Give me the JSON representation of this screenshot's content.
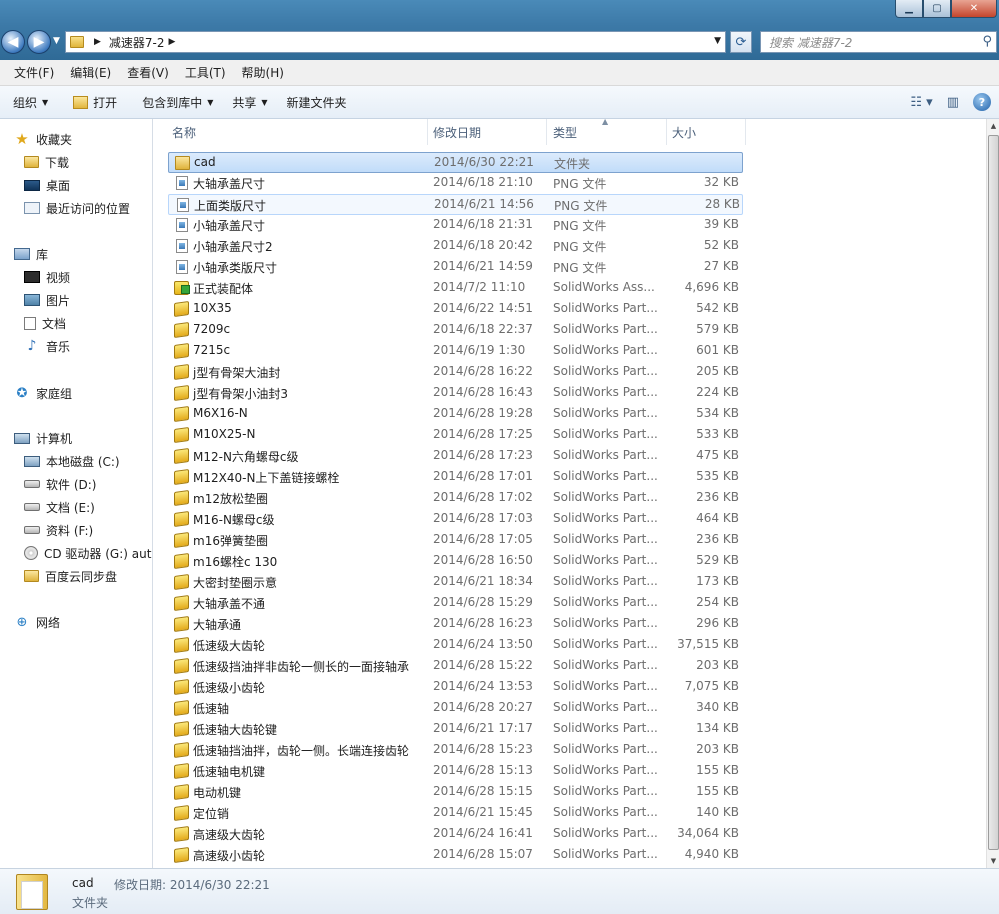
{
  "address": {
    "crumb": "减速器7-2",
    "search_placeholder": "搜索 减速器7-2"
  },
  "menu": [
    "文件(F)",
    "编辑(E)",
    "查看(V)",
    "工具(T)",
    "帮助(H)"
  ],
  "commands": {
    "organize": "组织",
    "open": "打开",
    "include_library": "包含到库中",
    "share": "共享",
    "new_folder": "新建文件夹"
  },
  "nav": {
    "favorites": "收藏夹",
    "downloads": "下载",
    "desktop": "桌面",
    "recent": "最近访问的位置",
    "libraries": "库",
    "videos": "视频",
    "pictures": "图片",
    "documents": "文档",
    "music": "音乐",
    "homegroup": "家庭组",
    "computer": "计算机",
    "drive_c": "本地磁盘 (C:)",
    "drive_d": "软件 (D:)",
    "drive_e": "文档 (E:)",
    "drive_f": "资料 (F:)",
    "drive_g": "CD 驱动器 (G:) auto",
    "baidu": "百度云同步盘",
    "network": "网络"
  },
  "columns": {
    "name": "名称",
    "date": "修改日期",
    "type": "类型",
    "size": "大小"
  },
  "files": [
    {
      "name": "cad",
      "date": "2014/6/30 22:21",
      "type": "文件夹",
      "size": "",
      "icon": "folder-icon"
    },
    {
      "name": "大轴承盖尺寸",
      "date": "2014/6/18 21:10",
      "type": "PNG 文件",
      "size": "32 KB",
      "icon": "png-file-icon"
    },
    {
      "name": "上面类版尺寸",
      "date": "2014/6/21 14:56",
      "type": "PNG 文件",
      "size": "28 KB",
      "icon": "png-file-icon"
    },
    {
      "name": "小轴承盖尺寸",
      "date": "2014/6/18 21:31",
      "type": "PNG 文件",
      "size": "39 KB",
      "icon": "png-file-icon"
    },
    {
      "name": "小轴承盖尺寸2",
      "date": "2014/6/18 20:42",
      "type": "PNG 文件",
      "size": "52 KB",
      "icon": "png-file-icon"
    },
    {
      "name": "小轴承类版尺寸",
      "date": "2014/6/21 14:59",
      "type": "PNG 文件",
      "size": "27 KB",
      "icon": "png-file-icon"
    },
    {
      "name": "正式装配体",
      "date": "2014/7/2 11:10",
      "type": "SolidWorks Ass...",
      "size": "4,696 KB",
      "icon": "assembly-file-icon"
    },
    {
      "name": "10X35",
      "date": "2014/6/22 14:51",
      "type": "SolidWorks Part...",
      "size": "542 KB",
      "icon": "part-file-icon"
    },
    {
      "name": "7209c",
      "date": "2014/6/18 22:37",
      "type": "SolidWorks Part...",
      "size": "579 KB",
      "icon": "part-file-icon"
    },
    {
      "name": "7215c",
      "date": "2014/6/19 1:30",
      "type": "SolidWorks Part...",
      "size": "601 KB",
      "icon": "part-file-icon"
    },
    {
      "name": "j型有骨架大油封",
      "date": "2014/6/28 16:22",
      "type": "SolidWorks Part...",
      "size": "205 KB",
      "icon": "part-file-icon"
    },
    {
      "name": "j型有骨架小油封3",
      "date": "2014/6/28 16:43",
      "type": "SolidWorks Part...",
      "size": "224 KB",
      "icon": "part-file-icon"
    },
    {
      "name": "M6X16-N",
      "date": "2014/6/28 19:28",
      "type": "SolidWorks Part...",
      "size": "534 KB",
      "icon": "part-file-icon"
    },
    {
      "name": "M10X25-N",
      "date": "2014/6/28 17:25",
      "type": "SolidWorks Part...",
      "size": "533 KB",
      "icon": "part-file-icon"
    },
    {
      "name": "M12-N六角螺母c级",
      "date": "2014/6/28 17:23",
      "type": "SolidWorks Part...",
      "size": "475 KB",
      "icon": "part-file-icon"
    },
    {
      "name": "M12X40-N上下盖链接螺栓",
      "date": "2014/6/28 17:01",
      "type": "SolidWorks Part...",
      "size": "535 KB",
      "icon": "part-file-icon"
    },
    {
      "name": "m12放松垫圈",
      "date": "2014/6/28 17:02",
      "type": "SolidWorks Part...",
      "size": "236 KB",
      "icon": "part-file-icon"
    },
    {
      "name": "M16-N螺母c级",
      "date": "2014/6/28 17:03",
      "type": "SolidWorks Part...",
      "size": "464 KB",
      "icon": "part-file-icon"
    },
    {
      "name": "m16弹簧垫圈",
      "date": "2014/6/28 17:05",
      "type": "SolidWorks Part...",
      "size": "236 KB",
      "icon": "part-file-icon"
    },
    {
      "name": "m16螺栓c 130",
      "date": "2014/6/28 16:50",
      "type": "SolidWorks Part...",
      "size": "529 KB",
      "icon": "part-file-icon"
    },
    {
      "name": "大密封垫圈示意",
      "date": "2014/6/21 18:34",
      "type": "SolidWorks Part...",
      "size": "173 KB",
      "icon": "part-file-icon"
    },
    {
      "name": "大轴承盖不通",
      "date": "2014/6/28 15:29",
      "type": "SolidWorks Part...",
      "size": "254 KB",
      "icon": "part-file-icon"
    },
    {
      "name": "大轴承通",
      "date": "2014/6/28 16:23",
      "type": "SolidWorks Part...",
      "size": "296 KB",
      "icon": "part-file-icon"
    },
    {
      "name": "低速级大齿轮",
      "date": "2014/6/24 13:50",
      "type": "SolidWorks Part...",
      "size": "37,515 KB",
      "icon": "part-file-icon"
    },
    {
      "name": "低速级挡油拌非齿轮一侧长的一面接轴承",
      "date": "2014/6/28 15:22",
      "type": "SolidWorks Part...",
      "size": "203 KB",
      "icon": "part-file-icon"
    },
    {
      "name": "低速级小齿轮",
      "date": "2014/6/24 13:53",
      "type": "SolidWorks Part...",
      "size": "7,075 KB",
      "icon": "part-file-icon"
    },
    {
      "name": "低速轴",
      "date": "2014/6/28 20:27",
      "type": "SolidWorks Part...",
      "size": "340 KB",
      "icon": "part-file-icon"
    },
    {
      "name": "低速轴大齿轮键",
      "date": "2014/6/21 17:17",
      "type": "SolidWorks Part...",
      "size": "134 KB",
      "icon": "part-file-icon"
    },
    {
      "name": "低速轴挡油拌，齿轮一侧。长端连接齿轮",
      "date": "2014/6/28 15:23",
      "type": "SolidWorks Part...",
      "size": "203 KB",
      "icon": "part-file-icon"
    },
    {
      "name": "低速轴电机键",
      "date": "2014/6/28 15:13",
      "type": "SolidWorks Part...",
      "size": "155 KB",
      "icon": "part-file-icon"
    },
    {
      "name": "电动机键",
      "date": "2014/6/28 15:15",
      "type": "SolidWorks Part...",
      "size": "155 KB",
      "icon": "part-file-icon"
    },
    {
      "name": "定位销",
      "date": "2014/6/21 15:45",
      "type": "SolidWorks Part...",
      "size": "140 KB",
      "icon": "part-file-icon"
    },
    {
      "name": "高速级大齿轮",
      "date": "2014/6/24 16:41",
      "type": "SolidWorks Part...",
      "size": "34,064 KB",
      "icon": "part-file-icon"
    },
    {
      "name": "高速级小齿轮",
      "date": "2014/6/28 15:07",
      "type": "SolidWorks Part...",
      "size": "4,940 KB",
      "icon": "part-file-icon"
    }
  ],
  "details": {
    "name": "cad",
    "date_label": "修改日期: 2014/6/30 22:21",
    "type": "文件夹"
  }
}
